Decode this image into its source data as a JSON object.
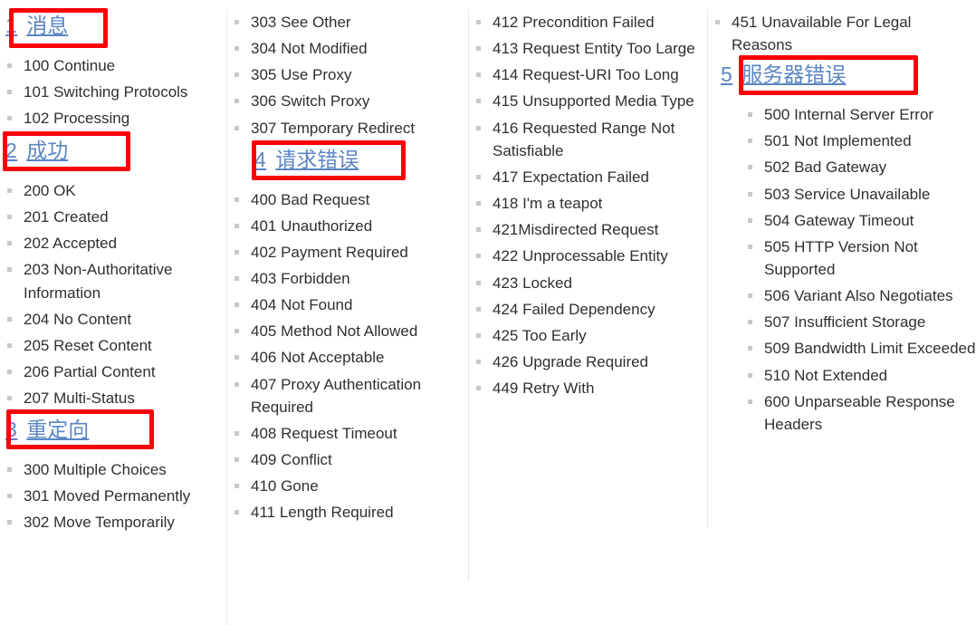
{
  "page": {
    "title": "HTTP 状态码",
    "heading_color": "#5a86c4",
    "annotation_color": "#fb0007",
    "text_color": "#2f2f2f",
    "bullet_color": "#c8c8c8",
    "divider_color": "#e8e8e8",
    "bullet_icon": "small-gray-square-bullet"
  },
  "sections": [
    {
      "id": "1",
      "number": "1",
      "title": "消息",
      "annotated": true
    },
    {
      "id": "2",
      "number": "2",
      "title": "成功",
      "annotated": true
    },
    {
      "id": "3",
      "number": "3",
      "title": "重定向",
      "annotated": true
    },
    {
      "id": "4",
      "number": "4",
      "title": "请求错误",
      "annotated": true
    },
    {
      "id": "5",
      "number": "5",
      "title": "服务器错误",
      "annotated": true
    }
  ],
  "columns": [
    {
      "index": 1,
      "blocks": [
        {
          "type": "heading",
          "section": 0
        },
        {
          "type": "list",
          "items": [
            "100 Continue",
            "101 Switching Protocols",
            "102 Processing"
          ]
        },
        {
          "type": "heading",
          "section": 1
        },
        {
          "type": "list",
          "items": [
            "200 OK",
            "201 Created",
            "202 Accepted",
            "203 Non-Authoritative Information",
            "204 No Content",
            "205 Reset Content",
            "206 Partial Content",
            "207 Multi-Status"
          ]
        },
        {
          "type": "heading",
          "section": 2
        },
        {
          "type": "list",
          "items": [
            "300 Multiple Choices",
            "301 Moved Permanently",
            "302 Move Temporarily"
          ]
        }
      ]
    },
    {
      "index": 2,
      "blocks": [
        {
          "type": "list",
          "items": [
            "303 See Other",
            "304 Not Modified",
            "305 Use Proxy",
            "306 Switch Proxy",
            "307 Temporary Redirect"
          ]
        },
        {
          "type": "heading",
          "section": 3
        },
        {
          "type": "list",
          "items": [
            "400 Bad Request",
            "401 Unauthorized",
            "402 Payment Required",
            "403 Forbidden",
            "404 Not Found",
            "405 Method Not Allowed",
            "406 Not Acceptable",
            "407 Proxy Authentication Required",
            "408 Request Timeout",
            "409 Conflict",
            "410 Gone",
            "411 Length Required"
          ]
        }
      ]
    },
    {
      "index": 3,
      "blocks": [
        {
          "type": "list",
          "items": [
            "412 Precondition Failed",
            "413 Request Entity Too Large",
            "414 Request-URI Too Long",
            "415 Unsupported Media Type",
            "416 Requested Range Not Satisfiable",
            "417 Expectation Failed",
            "418 I'm a teapot",
            "421Misdirected Request",
            "422 Unprocessable Entity",
            "423 Locked",
            "424 Failed Dependency",
            "425 Too Early",
            "426 Upgrade Required",
            "449 Retry With"
          ]
        }
      ]
    },
    {
      "index": 4,
      "blocks": [
        {
          "type": "list",
          "items": [
            "451 Unavailable For Legal Reasons"
          ]
        },
        {
          "type": "heading",
          "section": 4
        },
        {
          "type": "list",
          "items": [
            "500 Internal Server Error",
            "501 Not Implemented",
            "502 Bad Gateway",
            "503 Service Unavailable",
            "504 Gateway Timeout",
            "505 HTTP Version Not Supported",
            "506 Variant Also Negotiates",
            "507 Insufficient Storage",
            "509 Bandwidth Limit Exceeded",
            "510 Not Extended",
            "600 Unparseable Response Headers"
          ]
        }
      ]
    }
  ]
}
